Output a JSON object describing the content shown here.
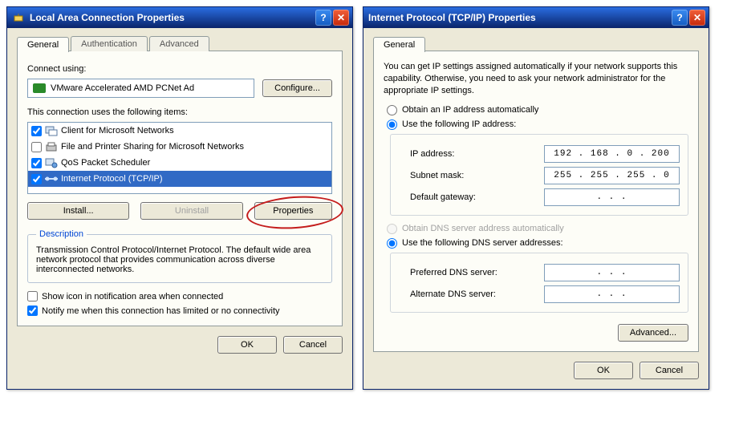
{
  "left": {
    "title": "Local Area Connection Properties",
    "tabs": [
      "General",
      "Authentication",
      "Advanced"
    ],
    "connect_using_label": "Connect using:",
    "adapter_name": "VMware Accelerated AMD PCNet Ad",
    "configure_btn": "Configure...",
    "items_label": "This connection uses the following items:",
    "items": [
      {
        "checked": true,
        "label": "Client for Microsoft Networks",
        "selected": false
      },
      {
        "checked": false,
        "label": "File and Printer Sharing for Microsoft Networks",
        "selected": false
      },
      {
        "checked": true,
        "label": "QoS Packet Scheduler",
        "selected": false
      },
      {
        "checked": true,
        "label": "Internet Protocol (TCP/IP)",
        "selected": true
      }
    ],
    "install_btn": "Install...",
    "uninstall_btn": "Uninstall",
    "properties_btn": "Properties",
    "desc_title": "Description",
    "desc_text": "Transmission Control Protocol/Internet Protocol. The default wide area network protocol that provides communication across diverse interconnected networks.",
    "show_icon_label": "Show icon in notification area when connected",
    "show_icon_checked": false,
    "notify_label": "Notify me when this connection has limited or no connectivity",
    "notify_checked": true,
    "ok_btn": "OK",
    "cancel_btn": "Cancel"
  },
  "right": {
    "title": "Internet Protocol (TCP/IP) Properties",
    "tabs": [
      "General"
    ],
    "intro_text": "You can get IP settings assigned automatically if your network supports this capability. Otherwise, you need to ask your network administrator for the appropriate IP settings.",
    "obtain_ip_label": "Obtain an IP address automatically",
    "use_ip_label": "Use the following IP address:",
    "ip_mode": "manual",
    "ip_label": "IP address:",
    "ip_value": "192 . 168 .  0  . 200",
    "subnet_label": "Subnet mask:",
    "subnet_value": "255 . 255 . 255 .  0",
    "gateway_label": "Default gateway:",
    "gateway_value": " .     .     . ",
    "obtain_dns_label": "Obtain DNS server address automatically",
    "use_dns_label": "Use the following DNS server addresses:",
    "dns_mode": "manual",
    "pref_dns_label": "Preferred DNS server:",
    "pref_dns_value": " .     .     . ",
    "alt_dns_label": "Alternate DNS server:",
    "alt_dns_value": " .     .     . ",
    "advanced_btn": "Advanced...",
    "ok_btn": "OK",
    "cancel_btn": "Cancel"
  }
}
